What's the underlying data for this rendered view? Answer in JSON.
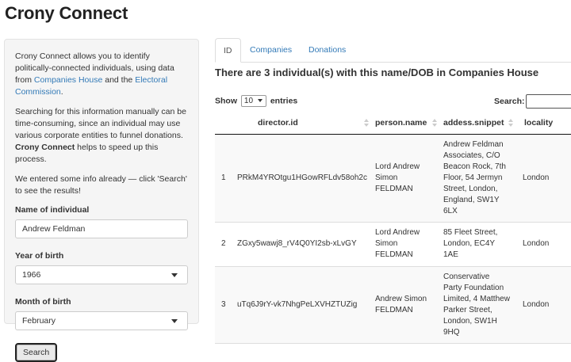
{
  "app": {
    "title": "Crony Connect"
  },
  "sidebar": {
    "intro": {
      "part1": "Crony Connect allows you to identify politically-connected individuals, using data from ",
      "link1": "Companies House",
      "part2": " and the ",
      "link2": "Electoral Commission",
      "part3": "."
    },
    "para2": {
      "part1": "Searching for this information manually can be time-consuming, since an individual may use various corporate entities to funnel donations. ",
      "bold": "Crony Connect",
      "part2": " helps to speed up this process."
    },
    "para3": "We entered some info already — click 'Search' to see the results!",
    "name_label": "Name of individual",
    "name_value": "Andrew Feldman",
    "year_label": "Year of birth",
    "year_value": "1966",
    "month_label": "Month of birth",
    "month_value": "February",
    "search_button": "Search"
  },
  "tabs": [
    {
      "label": "ID",
      "active": true
    },
    {
      "label": "Companies",
      "active": false
    },
    {
      "label": "Donations",
      "active": false
    }
  ],
  "main": {
    "heading": "There are 3 individual(s) with this name/DOB in Companies House",
    "show_label": "Show",
    "show_value": "10",
    "entries_label": "entries",
    "search_label": "Search:"
  },
  "table": {
    "columns": [
      "",
      "director.id",
      "person.name",
      "addess.snippet",
      "locality"
    ],
    "rows": [
      {
        "index": "1",
        "director_id": "PRkM4YROtgu1HGowRFLdv58oh2c",
        "person_name": "Lord Andrew Simon FELDMAN",
        "address": "Andrew Feldman Associates, C/O Beacon Rock, 7th Floor, 54 Jermyn Street, London, England, SW1Y 6LX",
        "locality": "London"
      },
      {
        "index": "2",
        "director_id": "ZGxy5wawj8_rV4Q0YI2sb-xLvGY",
        "person_name": "Lord Andrew Simon FELDMAN",
        "address": "85 Fleet Street, London, EC4Y 1AE",
        "locality": "London"
      },
      {
        "index": "3",
        "director_id": "uTq6J9rY-vk7NhgPeLXVHZTUZig",
        "person_name": "Andrew Simon FELDMAN",
        "address": "Conservative Party Foundation Limited, 4 Matthew Parker Street, London, SW1H 9HQ",
        "locality": "London"
      }
    ]
  }
}
